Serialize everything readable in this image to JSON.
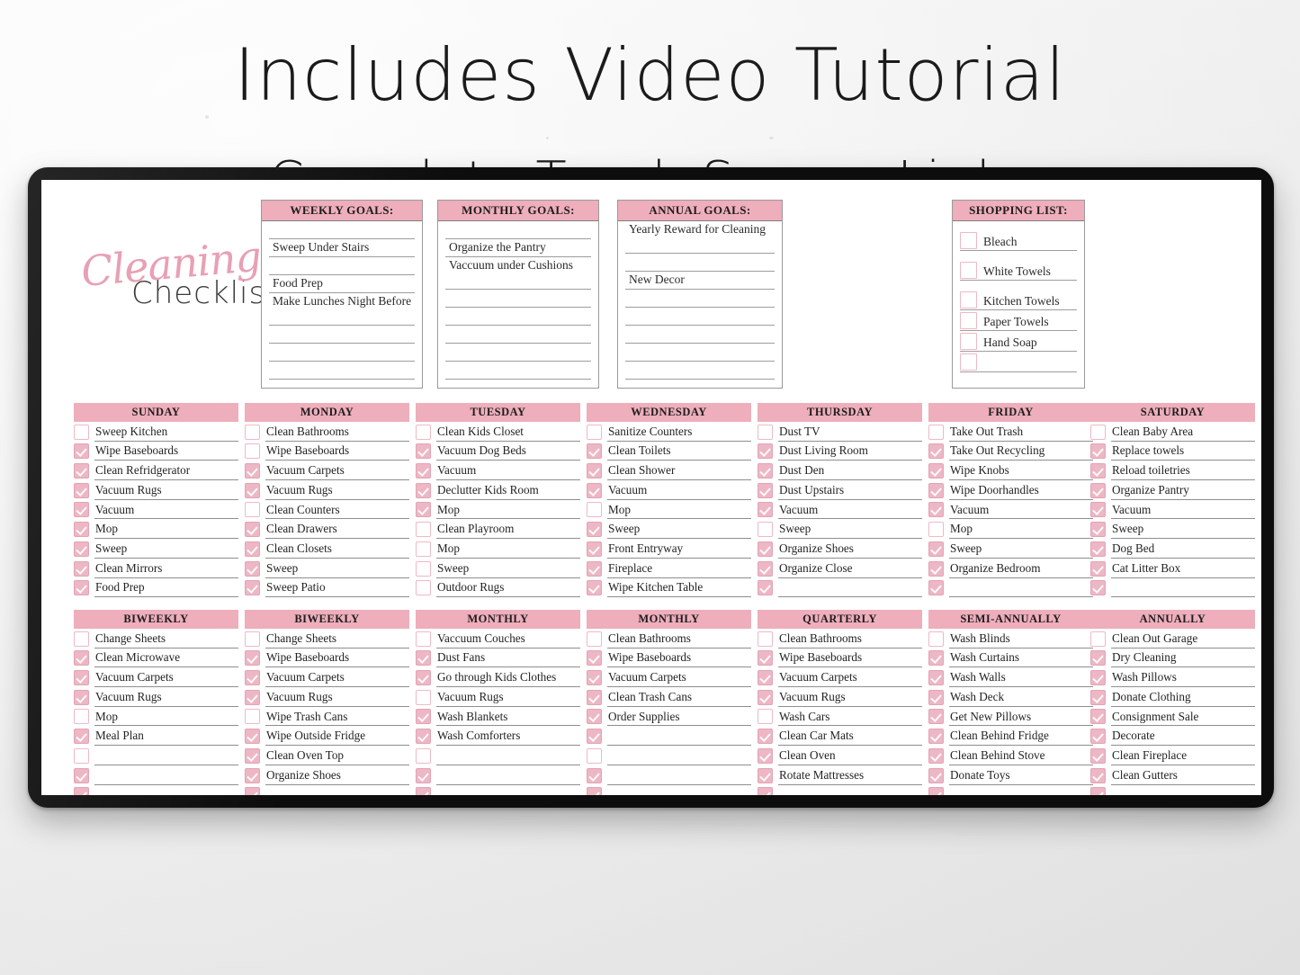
{
  "page": {
    "headline": "Includes Video Tutorial",
    "subline": "Complete Touch Screen Links"
  },
  "logo": {
    "word1": "Cleaning",
    "word2": "Checklist"
  },
  "goal_boxes": [
    {
      "title": "WEEKLY GOALS:",
      "rows": [
        "",
        "Sweep Under Stairs",
        "",
        "Food Prep",
        "Make Lunches Night Before",
        "",
        "",
        ""
      ]
    },
    {
      "title": "MONTHLY GOALS:",
      "rows": [
        "",
        "Organize the Pantry",
        "Vaccuum under Cushions",
        "",
        "",
        "",
        "",
        ""
      ]
    },
    {
      "title": "ANNUAL GOALS:",
      "rows": [
        "Yearly Reward for Cleaning",
        "",
        "New Decor",
        "",
        "",
        "",
        "",
        ""
      ]
    }
  ],
  "shopping_list": {
    "title": "SHOPPING LIST:",
    "items": [
      {
        "label": "Bleach",
        "checked": false
      },
      {
        "label": "White Towels",
        "checked": false
      },
      {
        "label": "Kitchen Towels",
        "checked": false
      },
      {
        "label": "Paper Towels",
        "checked": false
      },
      {
        "label": "Hand Soap",
        "checked": false
      },
      {
        "label": "",
        "checked": false
      }
    ]
  },
  "columns_top": [
    {
      "title": "SUNDAY",
      "tasks": [
        {
          "label": "Sweep Kitchen",
          "checked": false
        },
        {
          "label": "Wipe Baseboards",
          "checked": true
        },
        {
          "label": "Clean Refridgerator",
          "checked": true
        },
        {
          "label": "Vacuum Rugs",
          "checked": true
        },
        {
          "label": "Vacuum",
          "checked": true
        },
        {
          "label": "Mop",
          "checked": true
        },
        {
          "label": "Sweep",
          "checked": true
        },
        {
          "label": "Clean Mirrors",
          "checked": true
        },
        {
          "label": "Food Prep",
          "checked": true
        }
      ]
    },
    {
      "title": "MONDAY",
      "tasks": [
        {
          "label": "Clean Bathrooms",
          "checked": false
        },
        {
          "label": "Wipe Baseboards",
          "checked": false
        },
        {
          "label": "Vacuum Carpets",
          "checked": true
        },
        {
          "label": "Vacuum Rugs",
          "checked": true
        },
        {
          "label": "Clean Counters",
          "checked": false
        },
        {
          "label": "Clean Drawers",
          "checked": true
        },
        {
          "label": "Clean Closets",
          "checked": true
        },
        {
          "label": "Sweep",
          "checked": true
        },
        {
          "label": "Sweep Patio",
          "checked": true
        }
      ]
    },
    {
      "title": "TUESDAY",
      "tasks": [
        {
          "label": "Clean Kids Closet",
          "checked": false
        },
        {
          "label": "Vacuum Dog Beds",
          "checked": true
        },
        {
          "label": "Vacuum",
          "checked": true
        },
        {
          "label": "Declutter Kids Room",
          "checked": true
        },
        {
          "label": "Mop",
          "checked": true
        },
        {
          "label": "Clean Playroom",
          "checked": false
        },
        {
          "label": "Mop",
          "checked": false
        },
        {
          "label": "Sweep",
          "checked": false
        },
        {
          "label": "Outdoor Rugs",
          "checked": false
        }
      ]
    },
    {
      "title": "WEDNESDAY",
      "tasks": [
        {
          "label": "Sanitize Counters",
          "checked": false
        },
        {
          "label": "Clean Toilets",
          "checked": true
        },
        {
          "label": "Clean Shower",
          "checked": true
        },
        {
          "label": "Vacuum",
          "checked": true
        },
        {
          "label": "Mop",
          "checked": false
        },
        {
          "label": "Sweep",
          "checked": true
        },
        {
          "label": "Front Entryway",
          "checked": true
        },
        {
          "label": "Fireplace",
          "checked": true
        },
        {
          "label": "Wipe Kitchen Table",
          "checked": true
        }
      ]
    },
    {
      "title": "THURSDAY",
      "tasks": [
        {
          "label": "Dust TV",
          "checked": false
        },
        {
          "label": "Dust Living Room",
          "checked": true
        },
        {
          "label": "Dust Den",
          "checked": true
        },
        {
          "label": "Dust Upstairs",
          "checked": true
        },
        {
          "label": "Vacuum",
          "checked": true
        },
        {
          "label": "Sweep",
          "checked": false
        },
        {
          "label": "Organize Shoes",
          "checked": true
        },
        {
          "label": "Organize Close",
          "checked": true
        },
        {
          "label": "",
          "checked": true
        }
      ]
    },
    {
      "title": "FRIDAY",
      "tasks": [
        {
          "label": "Take Out Trash",
          "checked": false
        },
        {
          "label": "Take Out Recycling",
          "checked": true
        },
        {
          "label": "Wipe Knobs",
          "checked": true
        },
        {
          "label": "Wipe Doorhandles",
          "checked": true
        },
        {
          "label": "Vacuum",
          "checked": true
        },
        {
          "label": "Mop",
          "checked": false
        },
        {
          "label": "Sweep",
          "checked": true
        },
        {
          "label": "Organize Bedroom",
          "checked": true
        },
        {
          "label": "",
          "checked": true
        }
      ]
    },
    {
      "title": "SATURDAY",
      "tasks": [
        {
          "label": "Clean Baby Area",
          "checked": false
        },
        {
          "label": "Replace towels",
          "checked": true
        },
        {
          "label": "Reload toiletries",
          "checked": true
        },
        {
          "label": "Organize Pantry",
          "checked": true
        },
        {
          "label": "Vacuum",
          "checked": true
        },
        {
          "label": "Sweep",
          "checked": true
        },
        {
          "label": "Dog Bed",
          "checked": true
        },
        {
          "label": "Cat Litter Box",
          "checked": true
        },
        {
          "label": "",
          "checked": true
        }
      ]
    }
  ],
  "columns_bottom": [
    {
      "title": "BIWEEKLY",
      "tasks": [
        {
          "label": "Change Sheets",
          "checked": false
        },
        {
          "label": "Clean Microwave",
          "checked": true
        },
        {
          "label": "Vacuum Carpets",
          "checked": true
        },
        {
          "label": "Vacuum Rugs",
          "checked": true
        },
        {
          "label": "Mop",
          "checked": false
        },
        {
          "label": "Meal Plan",
          "checked": true
        },
        {
          "label": "",
          "checked": false
        },
        {
          "label": "",
          "checked": true
        },
        {
          "label": "",
          "checked": true
        }
      ]
    },
    {
      "title": "BIWEEKLY",
      "tasks": [
        {
          "label": "Change Sheets",
          "checked": false
        },
        {
          "label": "Wipe Baseboards",
          "checked": true
        },
        {
          "label": "Vacuum Carpets",
          "checked": true
        },
        {
          "label": "Vacuum Rugs",
          "checked": true
        },
        {
          "label": "Wipe Trash Cans",
          "checked": false
        },
        {
          "label": "Wipe Outside Fridge",
          "checked": true
        },
        {
          "label": "Clean Oven Top",
          "checked": true
        },
        {
          "label": "Organize Shoes",
          "checked": true
        },
        {
          "label": "",
          "checked": true
        }
      ]
    },
    {
      "title": "MONTHLY",
      "tasks": [
        {
          "label": "Vaccuum Couches",
          "checked": false
        },
        {
          "label": "Dust Fans",
          "checked": true
        },
        {
          "label": "Go through Kids Clothes",
          "checked": true
        },
        {
          "label": "Vacuum Rugs",
          "checked": false
        },
        {
          "label": "Wash Blankets",
          "checked": true
        },
        {
          "label": "Wash Comforters",
          "checked": true
        },
        {
          "label": "",
          "checked": false
        },
        {
          "label": "",
          "checked": true
        },
        {
          "label": "",
          "checked": true
        }
      ]
    },
    {
      "title": "MONTHLY",
      "tasks": [
        {
          "label": "Clean Bathrooms",
          "checked": false
        },
        {
          "label": "Wipe Baseboards",
          "checked": true
        },
        {
          "label": "Vacuum Carpets",
          "checked": true
        },
        {
          "label": "Clean Trash Cans",
          "checked": true
        },
        {
          "label": "Order Supplies",
          "checked": true
        },
        {
          "label": "",
          "checked": true
        },
        {
          "label": "",
          "checked": false
        },
        {
          "label": "",
          "checked": true
        },
        {
          "label": "",
          "checked": true
        }
      ]
    },
    {
      "title": "QUARTERLY",
      "tasks": [
        {
          "label": "Clean Bathrooms",
          "checked": false
        },
        {
          "label": "Wipe Baseboards",
          "checked": true
        },
        {
          "label": "Vacuum Carpets",
          "checked": true
        },
        {
          "label": "Vacuum Rugs",
          "checked": true
        },
        {
          "label": "Wash Cars",
          "checked": false
        },
        {
          "label": "Clean Car Mats",
          "checked": true
        },
        {
          "label": "Clean Oven",
          "checked": true
        },
        {
          "label": "Rotate Mattresses",
          "checked": true
        },
        {
          "label": "",
          "checked": true
        }
      ]
    },
    {
      "title": "SEMI-ANNUALLY",
      "tasks": [
        {
          "label": "Wash Blinds",
          "checked": false
        },
        {
          "label": "Wash Curtains",
          "checked": true
        },
        {
          "label": "Wash Walls",
          "checked": true
        },
        {
          "label": "Wash Deck",
          "checked": true
        },
        {
          "label": "Get New Pillows",
          "checked": true
        },
        {
          "label": "Clean Behind Fridge",
          "checked": true
        },
        {
          "label": "Clean Behind Stove",
          "checked": true
        },
        {
          "label": "Donate Toys",
          "checked": true
        },
        {
          "label": "",
          "checked": true
        }
      ]
    },
    {
      "title": "ANNUALLY",
      "tasks": [
        {
          "label": "Clean Out Garage",
          "checked": false
        },
        {
          "label": "Dry Cleaning",
          "checked": true
        },
        {
          "label": "Wash Pillows",
          "checked": true
        },
        {
          "label": "Donate Clothing",
          "checked": true
        },
        {
          "label": "Consignment Sale",
          "checked": true
        },
        {
          "label": "Decorate",
          "checked": true
        },
        {
          "label": "Clean Fireplace",
          "checked": true
        },
        {
          "label": "Clean Gutters",
          "checked": true
        },
        {
          "label": "",
          "checked": true
        }
      ]
    }
  ],
  "colors": {
    "accent_pink": "#eeaebc",
    "checkbox_pink": "#edb7c5",
    "checkbox_border": "#eeb9c6",
    "script_pink": "#e8a0b4",
    "text_dark": "#232323",
    "device_black": "#0d0d0d"
  }
}
